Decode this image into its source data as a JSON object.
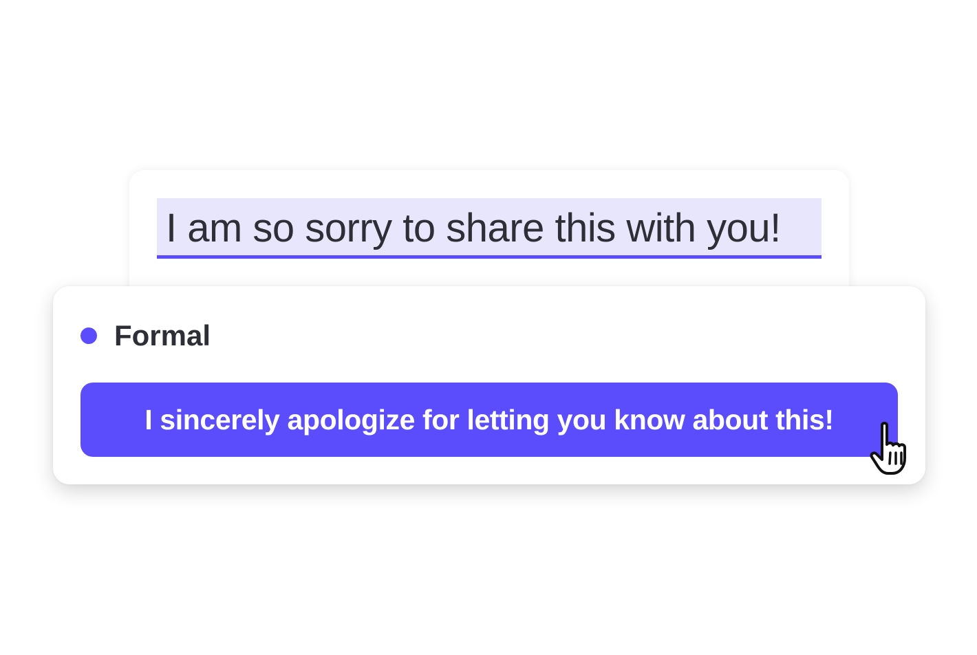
{
  "editor": {
    "highlighted_text": "I am so sorry to share this with you!"
  },
  "suggestion": {
    "tone_label": "Formal",
    "rewrite_text": "I sincerely apologize for letting you know about this!"
  },
  "colors": {
    "accent": "#5b4dfb",
    "highlight_bg": "#e8e6fd",
    "text": "#2e2f36"
  },
  "icons": {
    "tone_indicator": "dot-icon",
    "pointer": "hand-pointer-cursor-icon"
  }
}
